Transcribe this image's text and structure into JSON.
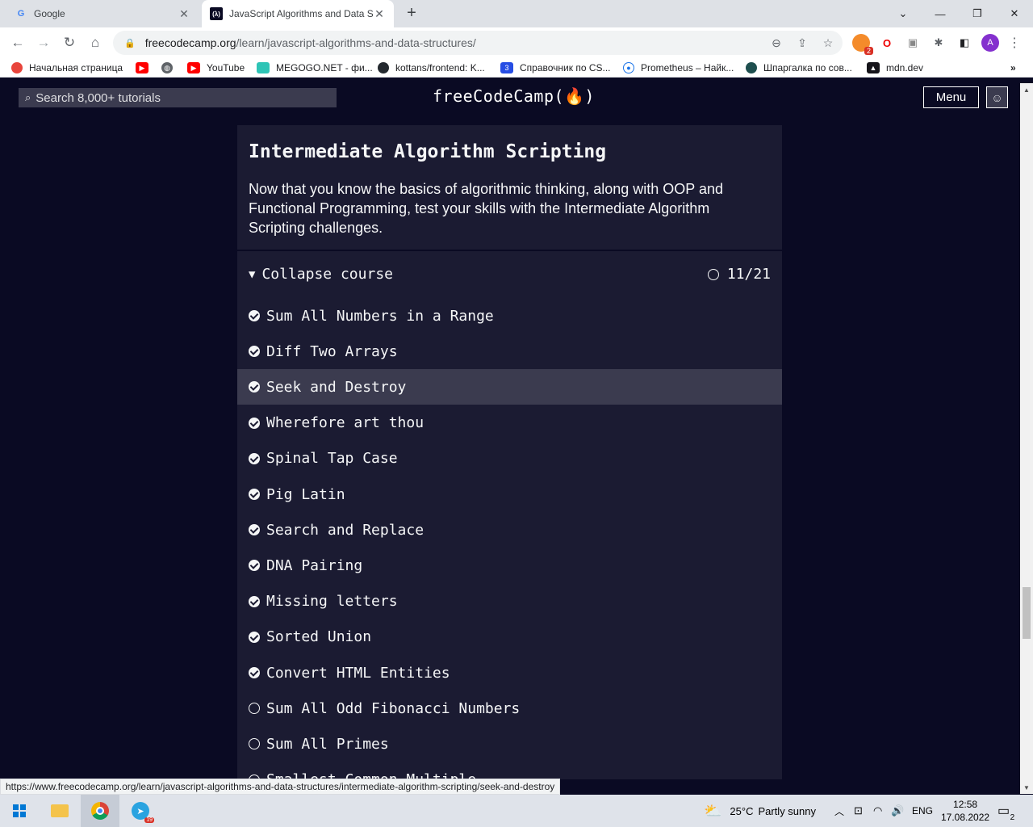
{
  "browser": {
    "tabs": [
      {
        "title": "Google",
        "active": false
      },
      {
        "title": "JavaScript Algorithms and Data Structures",
        "active": true
      }
    ],
    "url_host": "freecodecamp.org",
    "url_path": "/learn/javascript-algorithms-and-data-structures/",
    "bookmarks": [
      "Начальная страница",
      "",
      "",
      "YouTube",
      "MEGOGO.NET - фи...",
      "kottans/frontend: K...",
      "Справочник по CS...",
      "Prometheus – Найк...",
      "Шпаргалка по сов...",
      "mdn.dev"
    ],
    "bookmarks_more": "»",
    "ext_badge": "2",
    "profile_initial": "A",
    "status_url": "https://www.freecodecamp.org/learn/javascript-algorithms-and-data-structures/intermediate-algorithm-scripting/seek-and-destroy"
  },
  "fcc": {
    "search_placeholder": "Search 8,000+ tutorials",
    "logo": "freeCodeCamp(🔥)",
    "menu_label": "Menu"
  },
  "block": {
    "title": "Intermediate Algorithm Scripting",
    "description": "Now that you know the basics of algorithmic thinking, along with OOP and Functional Programming, test your skills with the Intermediate Algorithm Scripting challenges.",
    "collapse_label": "Collapse course",
    "progress": "11/21",
    "completed": 11,
    "total": 21,
    "lessons": [
      {
        "title": "Sum All Numbers in a Range",
        "done": true
      },
      {
        "title": "Diff Two Arrays",
        "done": true
      },
      {
        "title": "Seek and Destroy",
        "done": true,
        "selected": true
      },
      {
        "title": "Wherefore art thou",
        "done": true
      },
      {
        "title": "Spinal Tap Case",
        "done": true
      },
      {
        "title": "Pig Latin",
        "done": true
      },
      {
        "title": "Search and Replace",
        "done": true
      },
      {
        "title": "DNA Pairing",
        "done": true
      },
      {
        "title": "Missing letters",
        "done": true
      },
      {
        "title": "Sorted Union",
        "done": true
      },
      {
        "title": "Convert HTML Entities",
        "done": true
      },
      {
        "title": "Sum All Odd Fibonacci Numbers",
        "done": false
      },
      {
        "title": "Sum All Primes",
        "done": false
      },
      {
        "title": "Smallest Common Multiple",
        "done": false
      }
    ]
  },
  "taskbar": {
    "weather_temp": "25°C",
    "weather_text": "Partly sunny",
    "lang": "ENG",
    "time": "12:58",
    "date": "17.08.2022",
    "notif_count": "2",
    "telegram_badge": "19"
  },
  "colors": {
    "bg": "#0a0a23",
    "panel": "#1b1b32",
    "selected": "#3b3b4f",
    "text": "#f5f6f7"
  }
}
